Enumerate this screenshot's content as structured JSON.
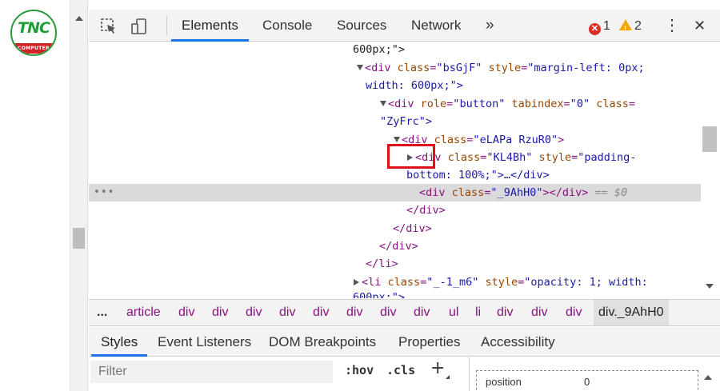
{
  "page": {
    "logo_text": "TNC",
    "logo_subtext": "COMPUTER"
  },
  "toolbar": {
    "tabs": [
      "Elements",
      "Console",
      "Sources",
      "Network"
    ],
    "more_tabs": "»",
    "error_count": "1",
    "warning_count": "2",
    "menu_glyph": "⋮",
    "close_glyph": "✕"
  },
  "tree": {
    "lines": [
      {
        "text": "600px;\">"
      },
      {
        "tag": "<div ",
        "attrs": [
          [
            "class",
            "bsGjF"
          ],
          [
            "style",
            "margin-left: 0px;"
          ]
        ]
      },
      {
        "text": "width: 600px;\">"
      },
      {
        "tag": "<div ",
        "attrs": [
          [
            "role",
            "button"
          ],
          [
            "tabindex",
            "0"
          ],
          [
            "class",
            ""
          ]
        ]
      },
      {
        "text": "\"ZyFrc\">"
      },
      {
        "tag": "<div ",
        "attrs": [
          [
            "class",
            "eLAPa RzuR0"
          ]
        ]
      },
      {
        "tag": "<div ",
        "attrs": [
          [
            "class",
            "KL4Bh"
          ],
          [
            "style",
            "padding-"
          ]
        ]
      },
      {
        "text": "bottom: 100%;\">…</div>"
      },
      {
        "tag": "<div ",
        "attrs": [
          [
            "class",
            "_9AhH0"
          ]
        ],
        "suffix": "</div>",
        "marker": "== $0"
      },
      {
        "text": "</div>"
      },
      {
        "text": "</div>"
      },
      {
        "text": "</div>"
      },
      {
        "text": "</li>"
      },
      {
        "tag": "<li ",
        "attrs": [
          [
            "class",
            "_-1_m6"
          ],
          [
            "style",
            "opacity: 1; width:"
          ]
        ]
      },
      {
        "text": "600px;\">"
      }
    ],
    "row_dots": "•••"
  },
  "breadcrumb": {
    "items": [
      "...",
      "article",
      "div",
      "div",
      "div",
      "div",
      "div",
      "div",
      "div",
      "div",
      "ul",
      "li",
      "div",
      "div",
      "div",
      "div._9AhH0"
    ]
  },
  "styles_pane": {
    "tabs": [
      "Styles",
      "Event Listeners",
      "DOM Breakpoints",
      "Properties",
      "Accessibility"
    ],
    "filter_placeholder": "Filter",
    "hov_label": ":hov",
    "cls_label": ".cls",
    "add_label": "+",
    "position_label": "position",
    "position_value": "0"
  },
  "colors": {
    "tag": "#881280",
    "attr_name": "#994500",
    "attr_value": "#1a1aa6",
    "highlight_box": "#e0101a",
    "active_tab": "#1a73e8"
  }
}
